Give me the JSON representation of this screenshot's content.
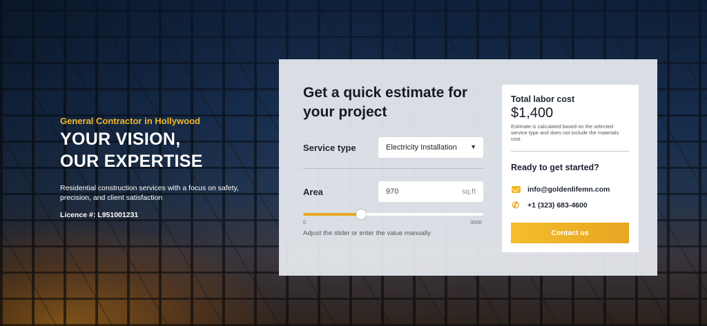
{
  "hero": {
    "eyebrow": "General Contractor in Hollywood",
    "title_line1": "YOUR VISION,",
    "title_line2": "OUR EXPERTISE",
    "description": "Residential construction services with a focus on safety, precision, and client satisfaction",
    "licence": "Licence #: L951001231"
  },
  "estimate": {
    "title": "Get a quick estimate for your project",
    "service_type_label": "Service type",
    "service_type_value": "Electricity Installation",
    "area_label": "Area",
    "area_value": "970",
    "area_unit": "sq.ft",
    "slider": {
      "min": 0,
      "max": 3000,
      "value": 970,
      "min_label": "0",
      "max_label": "3000",
      "hint": "Adjust the slider or enter the value manually"
    }
  },
  "cost_card": {
    "label": "Total labor cost",
    "value": "$1,400",
    "note": "Estimate is calculated based on the selected service type and does not include the materials cost",
    "cta_title": "Ready to get started?",
    "email": "info@goldenlifemn.com",
    "phone": "+1 (323) 683-4600",
    "button_label": "Contact us"
  },
  "colors": {
    "accent": "#f2b824",
    "slider_fill": "#e8a522"
  },
  "icons": {
    "select": "chevron-down-icon",
    "email": "mail-icon",
    "phone": "phone-icon"
  }
}
